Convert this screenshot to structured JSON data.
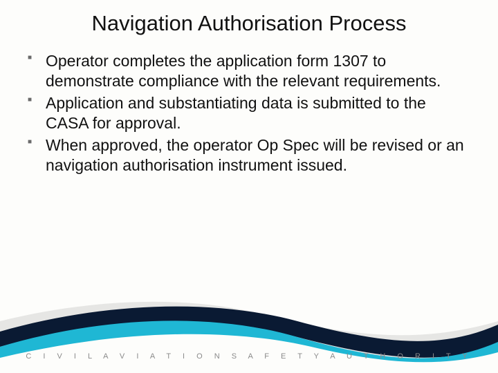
{
  "title": "Navigation Authorisation Process",
  "bullets": [
    "Operator completes the application form 1307 to demonstrate compliance with the relevant requirements.",
    "Application and substantiating data is submitted to the CASA for approval.",
    "When approved, the operator Op Spec will be revised or an navigation authorisation instrument issued."
  ],
  "footer": "C I V I L   A V I A T I O N   S A F E T Y   A U T H O R I T Y"
}
